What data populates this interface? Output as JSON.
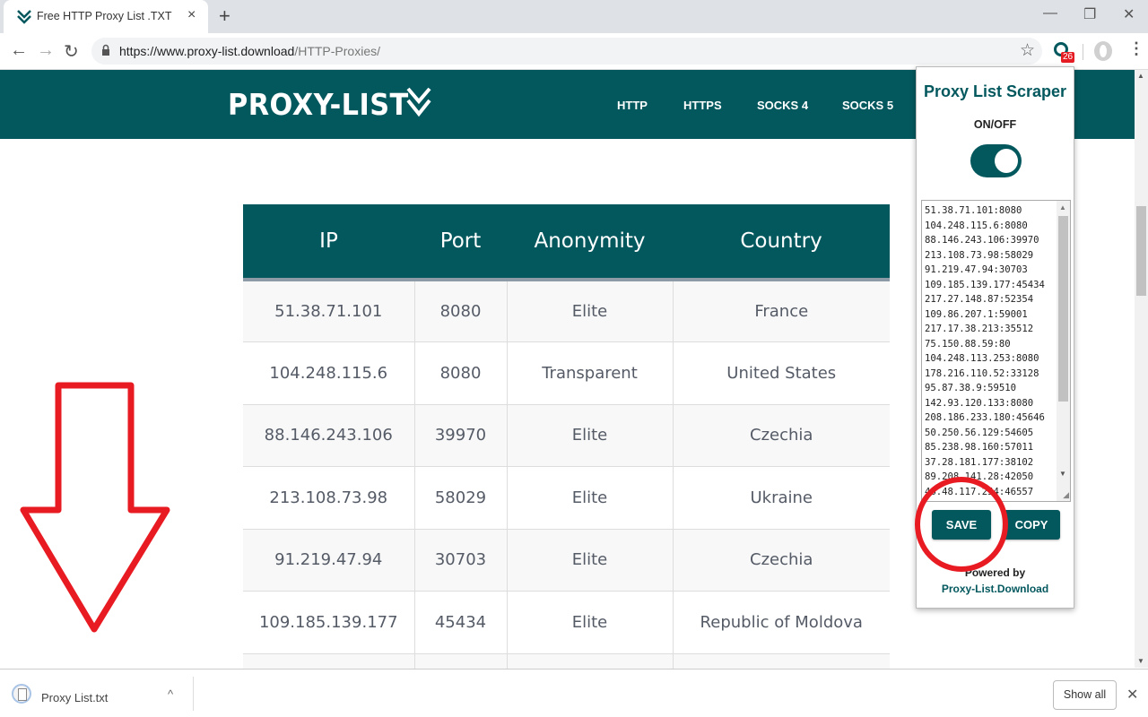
{
  "browser": {
    "tab": {
      "title": "Free HTTP Proxy List .TXT",
      "close_icon": "×"
    },
    "new_tab_icon": "+",
    "window_controls": {
      "minimize": "—",
      "restore": "❐",
      "close": "✕"
    },
    "nav": {
      "back": "←",
      "forward": "→",
      "reload": "↻"
    },
    "address": {
      "host": "https://www.proxy-list.download",
      "path": "/HTTP-Proxies/"
    },
    "bookmark_icon": "☆",
    "extension_badge": "26",
    "menu_icon": "⋮"
  },
  "site": {
    "logo": "PROXY-LIST",
    "nav": [
      "HTTP",
      "HTTPS",
      "SOCKS 4",
      "SOCKS 5"
    ]
  },
  "table": {
    "headers": [
      "IP",
      "Port",
      "Anonymity",
      "Country"
    ],
    "rows": [
      [
        "51.38.71.101",
        "8080",
        "Elite",
        "France"
      ],
      [
        "104.248.115.6",
        "8080",
        "Transparent",
        "United States"
      ],
      [
        "88.146.243.106",
        "39970",
        "Elite",
        "Czechia"
      ],
      [
        "213.108.73.98",
        "58029",
        "Elite",
        "Ukraine"
      ],
      [
        "91.219.47.94",
        "30703",
        "Elite",
        "Czechia"
      ],
      [
        "109.185.139.177",
        "45434",
        "Elite",
        "Republic of Moldova"
      ],
      [
        "",
        "",
        "",
        ""
      ]
    ]
  },
  "popup": {
    "title": "Proxy List Scraper",
    "toggle_label": "ON/OFF",
    "toggle_on": true,
    "proxies": [
      "51.38.71.101:8080",
      "104.248.115.6:8080",
      "88.146.243.106:39970",
      "213.108.73.98:58029",
      "91.219.47.94:30703",
      "109.185.139.177:45434",
      "217.27.148.87:52354",
      "109.86.207.1:59001",
      "217.17.38.213:35512",
      "75.150.88.59:80",
      "104.248.113.253:8080",
      "178.216.110.52:33128",
      "95.87.38.9:59510",
      "142.93.120.133:8080",
      "208.186.233.180:45646",
      "50.250.56.129:54605",
      "85.238.98.160:57011",
      "37.28.181.177:38102",
      "89.208.141.28:42050",
      "46.48.117.254:46557"
    ],
    "save_label": "SAVE",
    "copy_label": "COPY",
    "powered_by": "Powered by",
    "powered_link": "Proxy-List.Download"
  },
  "download_shelf": {
    "file_name": "Proxy List.txt",
    "caret": "^",
    "show_all": "Show all",
    "close_icon": "✕"
  },
  "colors": {
    "brand": "#03585e",
    "annotation": "#e81b23",
    "badge": "#e51c23"
  }
}
